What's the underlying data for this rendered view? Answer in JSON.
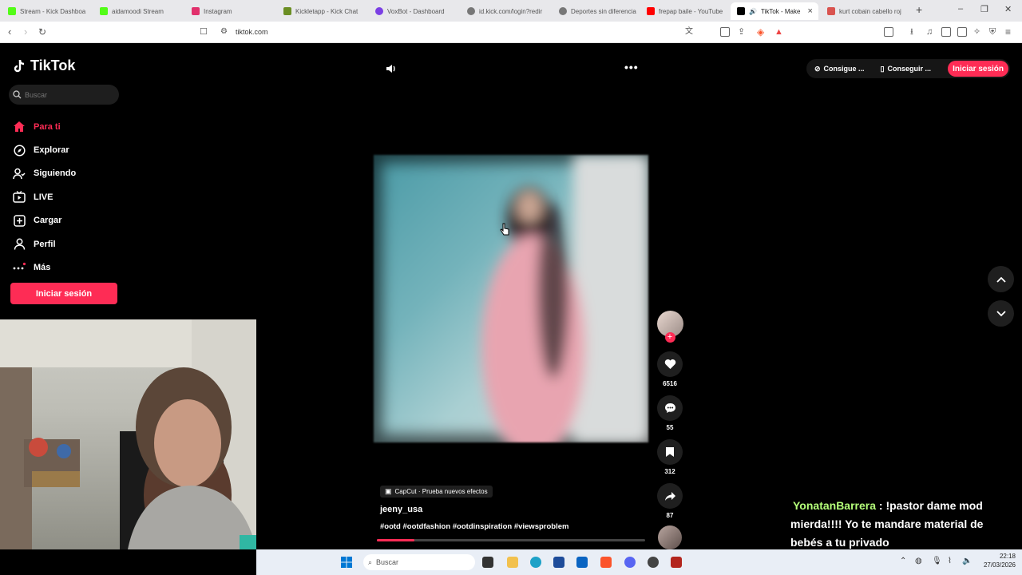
{
  "browser": {
    "tabs": [
      {
        "title": "Stream - Kick Dashboa",
        "color": "#53fc18"
      },
      {
        "title": "aidamoodi Stream",
        "color": "#53fc18"
      },
      {
        "title": "Instagram",
        "color": "#e1306c"
      },
      {
        "title": "Kickletapp - Kick Chat",
        "color": "#6b8e23"
      },
      {
        "title": "VoxBot - Dashboard",
        "color": "#7b3fe4"
      },
      {
        "title": "id.kick.com/login?redir",
        "color": "#777777"
      },
      {
        "title": "Deportes sin diferencia",
        "color": "#777777"
      },
      {
        "title": "frepap baile - YouTube",
        "color": "#ff0000"
      },
      {
        "title": "TikTok - Make",
        "color": "#000000"
      },
      {
        "title": "kurt cobain cabello roj",
        "color": "#d9534f"
      }
    ],
    "url": "tiktok.com"
  },
  "tiktok": {
    "logo": "TikTok",
    "search_placeholder": "Buscar",
    "menu": [
      {
        "label": "Para ti",
        "icon": "home-icon"
      },
      {
        "label": "Explorar",
        "icon": "compass-icon"
      },
      {
        "label": "Siguiendo",
        "icon": "following-icon"
      },
      {
        "label": "LIVE",
        "icon": "live-icon"
      },
      {
        "label": "Cargar",
        "icon": "upload-icon"
      },
      {
        "label": "Perfil",
        "icon": "profile-icon"
      },
      {
        "label": "Más",
        "icon": "more-dots-icon"
      }
    ],
    "login_button": "Iniciar sesión",
    "top_buttons": {
      "coins": "Consigue ...",
      "app": "Conseguir ...",
      "login": "Iniciar sesión"
    },
    "video": {
      "effect": "CapCut · Prueba nuevos efectos",
      "author": "jeeny_usa",
      "hashtags": "#ootd #ootdfashion #ootdinspiration #viewsproblem",
      "progress": 0.14,
      "likes": "6516",
      "comments": "55",
      "saves": "312",
      "shares": "87"
    }
  },
  "chat": {
    "username": "YonatanBarrera",
    "message": "!pastor dame mod mierda!!!! Yo te mandare material de bebés a tu privado"
  },
  "taskbar": {
    "search_placeholder": "Buscar",
    "time": "22:18",
    "date": "27/03/2026"
  },
  "colors": {
    "accent": "#fe2c55",
    "chat_user": "#b5ff7a"
  }
}
